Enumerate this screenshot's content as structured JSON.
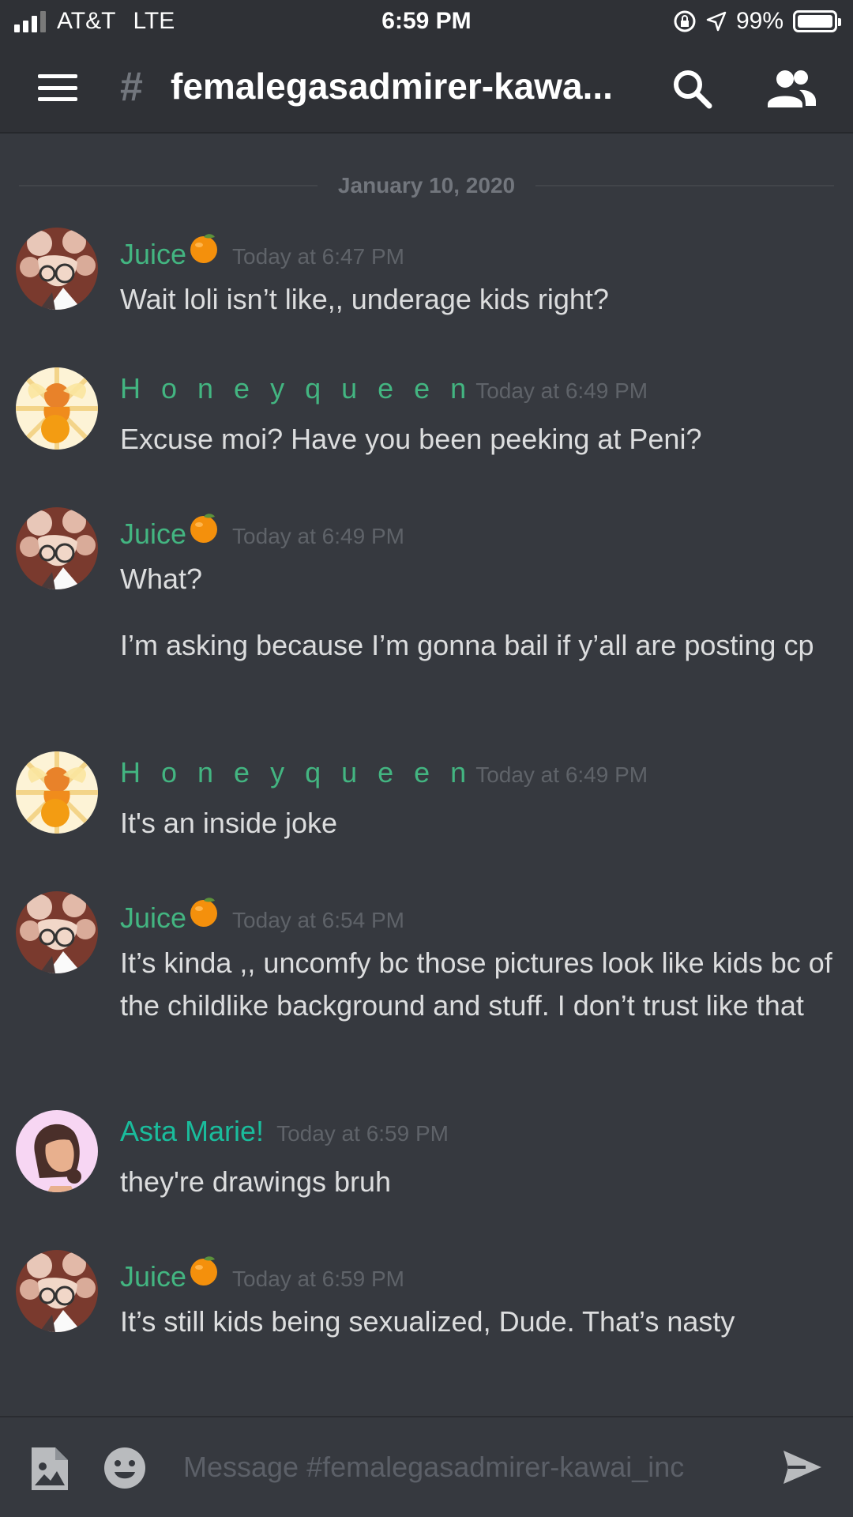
{
  "status_bar": {
    "carrier": "AT&T",
    "network": "LTE",
    "time": "6:59 PM",
    "battery": "99%",
    "battery_level": 0.99
  },
  "header": {
    "hash": "#",
    "channel_name": "femalegasadmirer-kawa..."
  },
  "date_divider": "January 10, 2020",
  "messages": [
    {
      "author": "Juice",
      "timestamp": "Today at 6:47 PM",
      "lines": [
        "Wait loli isn’t like,, underage kids right?"
      ]
    },
    {
      "author": "H o n e y q u e e n",
      "timestamp": "Today at 6:49 PM",
      "lines": [
        "Excuse moi? Have you been peeking at Peni?"
      ]
    },
    {
      "author": "Juice",
      "timestamp": "Today at 6:49 PM",
      "lines": [
        "What?",
        "I’m asking because I’m gonna bail if y’all are posting cp"
      ]
    },
    {
      "author": "H o n e y q u e e n",
      "timestamp": "Today at 6:49 PM",
      "lines": [
        "It's an inside joke"
      ]
    },
    {
      "author": "Juice",
      "timestamp": "Today at 6:54 PM",
      "lines": [
        "It’s kinda ,, uncomfy bc those pictures look like kids bc of the childlike background and stuff. I don’t trust like that"
      ]
    },
    {
      "author": "Asta Marie!",
      "timestamp": "Today at 6:59 PM",
      "lines": [
        "they're drawings bruh"
      ]
    },
    {
      "author": "Juice",
      "timestamp": "Today at 6:59 PM",
      "lines": [
        "It’s still kids being sexualized, Dude. That’s nasty"
      ]
    }
  ],
  "input": {
    "placeholder": "Message #femalegasadmirer-kawai_inc"
  },
  "icons": {
    "menu": "hamburger-icon",
    "search": "search-icon",
    "members": "members-icon",
    "attach": "image-attach-icon",
    "emoji": "emoji-icon",
    "send": "send-icon",
    "orange": "orange-emoji"
  },
  "colors": {
    "background": "#36393f",
    "header": "#2f3136",
    "author_green": "#43b581",
    "author_teal": "#1abc9c",
    "timestamp": "#5f6369"
  }
}
